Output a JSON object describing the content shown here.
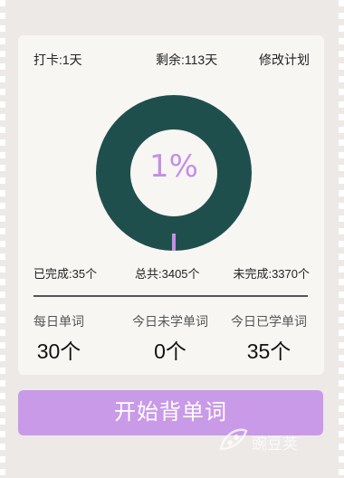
{
  "header": {
    "checkin": "打卡:1天",
    "remaining": "剩余:113天",
    "modify_plan": "修改计划"
  },
  "progress": {
    "percent_label": "1%",
    "fraction": 0.01
  },
  "stats": {
    "completed": "已完成:35个",
    "total": "总共:3405个",
    "not_completed": "未完成:3370个"
  },
  "daily": [
    {
      "label": "每日单词",
      "value": "30个"
    },
    {
      "label": "今日未学单词",
      "value": "0个"
    },
    {
      "label": "今日已学单词",
      "value": "35个"
    }
  ],
  "start_button": "开始背单词",
  "watermark": "豌豆荚",
  "colors": {
    "ring": "#1f4f4d",
    "accent": "#c99ae8",
    "progress": "#c58fe6"
  }
}
